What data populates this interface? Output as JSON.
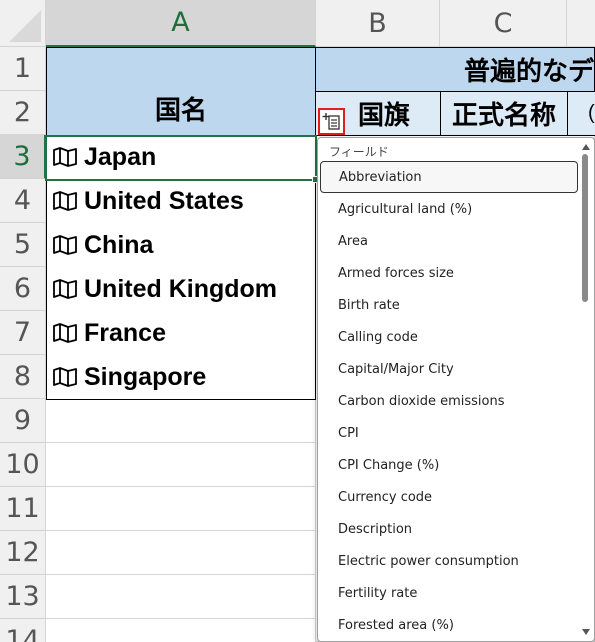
{
  "columns": [
    "A",
    "B",
    "C"
  ],
  "rows": [
    "1",
    "2",
    "3",
    "4",
    "5",
    "6",
    "7",
    "8",
    "9",
    "10",
    "11",
    "12",
    "13",
    "14"
  ],
  "headers": {
    "a_label": "国名",
    "bcd_banner": "普遍的なデ",
    "b_label": "国旗",
    "c_label": "正式名称",
    "d_partial": "("
  },
  "countries": [
    "Japan",
    "United States",
    "China",
    "United Kingdom",
    "France",
    "Singapore"
  ],
  "active_cell": "A3",
  "dropdown": {
    "title": "フィールド",
    "items": [
      "Abbreviation",
      "Agricultural land (%)",
      "Area",
      "Armed forces size",
      "Birth rate",
      "Calling code",
      "Capital/Major City",
      "Carbon dioxide emissions",
      "CPI",
      "CPI Change (%)",
      "Currency code",
      "Description",
      "Electric power consumption",
      "Fertility rate",
      "Forested area (%)"
    ],
    "focused_item": "Abbreviation"
  },
  "colors": {
    "header_blue": "#bdd7ee",
    "header_light": "#ddebf7",
    "selection_green": "#217346",
    "insert_button_border": "#e0201b"
  },
  "icons": {
    "country_cell": "map-icon",
    "insert_data": "insert-data-icon"
  }
}
